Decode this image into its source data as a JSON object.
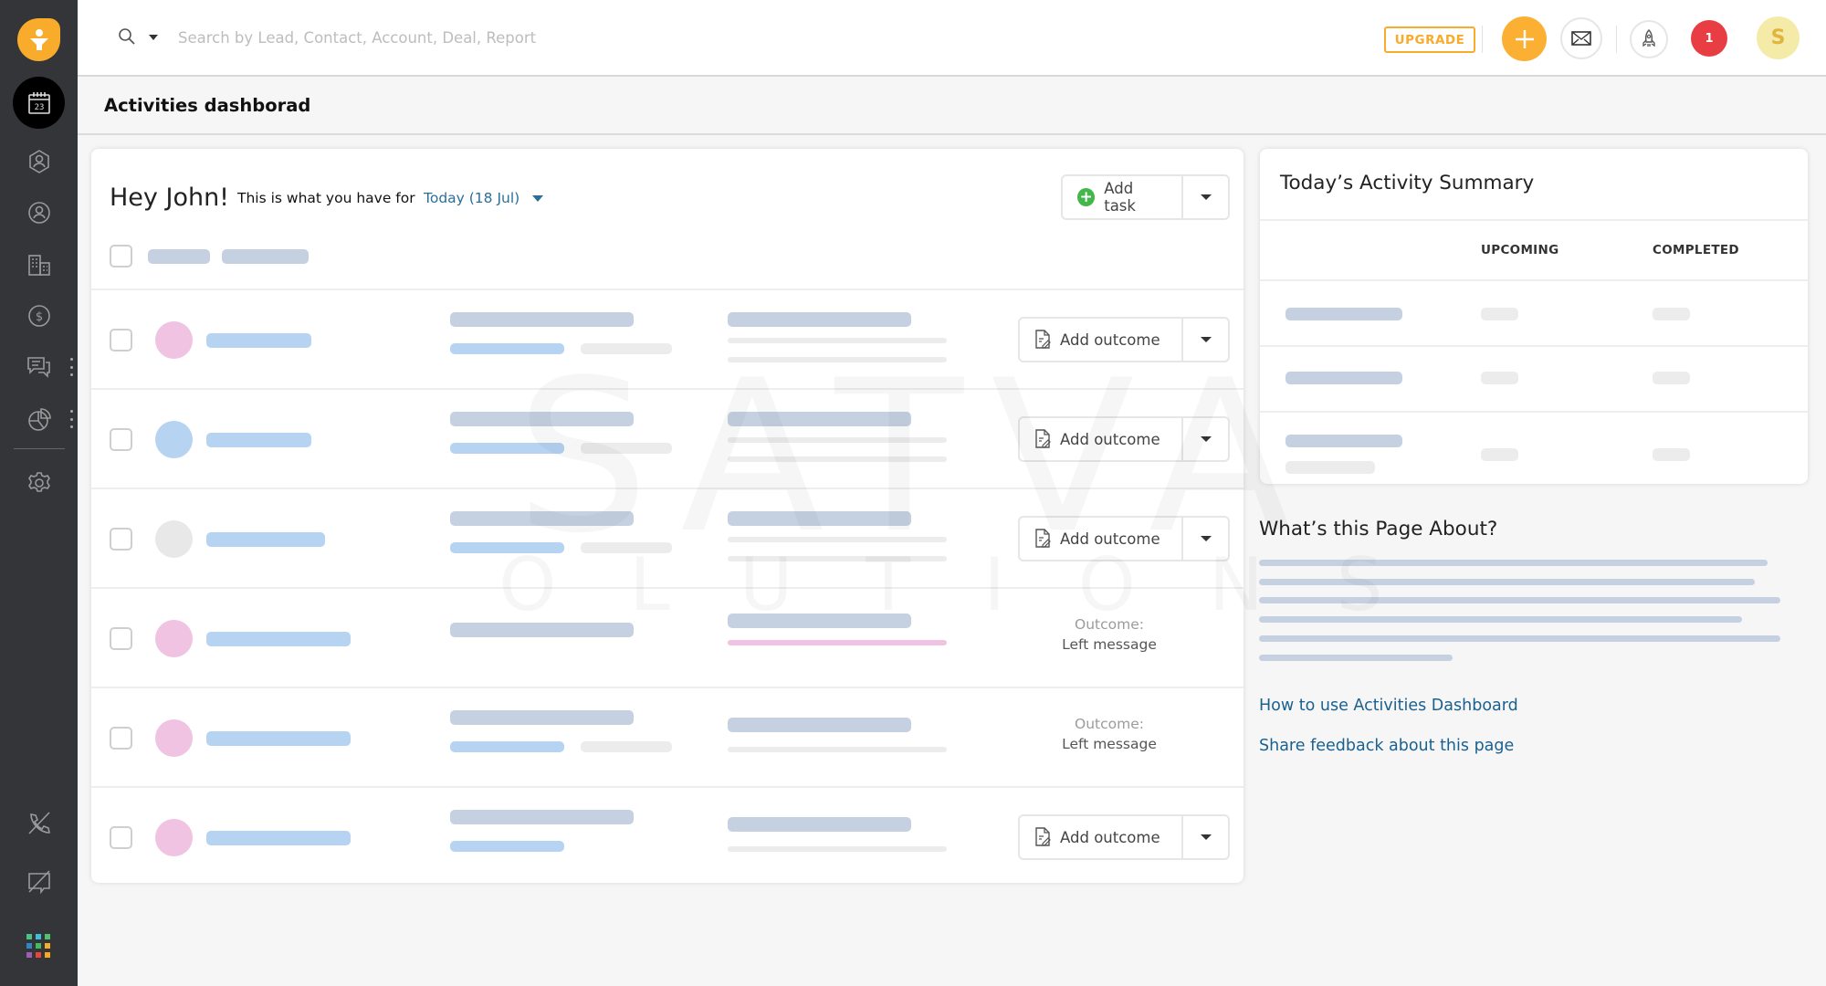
{
  "sidebar": {
    "logo": "app-logo-funnel",
    "items": [
      {
        "name": "activities",
        "icon": "calendar-icon",
        "label_date": "23",
        "active": true
      },
      {
        "name": "leads",
        "icon": "lead-icon"
      },
      {
        "name": "contacts",
        "icon": "contact-icon"
      },
      {
        "name": "accounts",
        "icon": "building-icon"
      },
      {
        "name": "deals",
        "icon": "dollar-icon"
      },
      {
        "name": "conversations",
        "icon": "chat-icon",
        "has_more": true
      },
      {
        "name": "reports",
        "icon": "pie-chart-icon",
        "has_more": true
      },
      {
        "name": "settings",
        "icon": "gear-icon"
      }
    ],
    "bottom_items": [
      {
        "name": "phone",
        "icon": "phone-off-icon"
      },
      {
        "name": "chat",
        "icon": "chat-off-icon"
      },
      {
        "name": "apps",
        "icon": "apps-grid-icon"
      }
    ],
    "apps_grid_colors": [
      "#45c585",
      "#3dc0e0",
      "#4fc36b",
      "#2f86c9",
      "#3cbf5c",
      "#f9ab2c",
      "#9b5eb3",
      "#e8433d",
      "#f7a823"
    ]
  },
  "topbar": {
    "search_placeholder": "Search by Lead, Contact, Account, Deal, Report",
    "upgrade_label": "UPGRADE",
    "notification_count": "1",
    "user_initial": "S"
  },
  "page": {
    "title": "Activities dashborad"
  },
  "main": {
    "greeting": "Hey John!",
    "subtitle": "This is what you have for",
    "date_filter": "Today (18 Jul)",
    "add_task_label": "Add task",
    "rows": [
      {
        "avatar_color": "#f0c3e2",
        "action": "Add outcome"
      },
      {
        "avatar_color": "#b6d3f2",
        "action": "Add outcome"
      },
      {
        "avatar_color": "#e8e8e8",
        "action": "Add outcome"
      },
      {
        "avatar_color": "#f0c3e2",
        "outcome_label": "Outcome:",
        "outcome_value": "Left message"
      },
      {
        "avatar_color": "#f0c3e2",
        "outcome_label": "Outcome:",
        "outcome_value": "Left message"
      },
      {
        "avatar_color": "#f0c3e2",
        "action": "Add outcome"
      }
    ]
  },
  "summary": {
    "title": "Today’s Activity Summary",
    "columns": [
      "UPCOMING",
      "COMPLETED"
    ]
  },
  "about": {
    "title": "What’s this Page About?",
    "links": [
      "How to use Activities Dashboard",
      "Share feedback about this page"
    ]
  },
  "watermark": {
    "line1": "SATVA",
    "line2": "SOLUTIONS"
  },
  "colors": {
    "accent": "#f9ab2c",
    "link": "#1a6190",
    "sidebar_bg": "#343538",
    "notification": "#e83e43"
  }
}
